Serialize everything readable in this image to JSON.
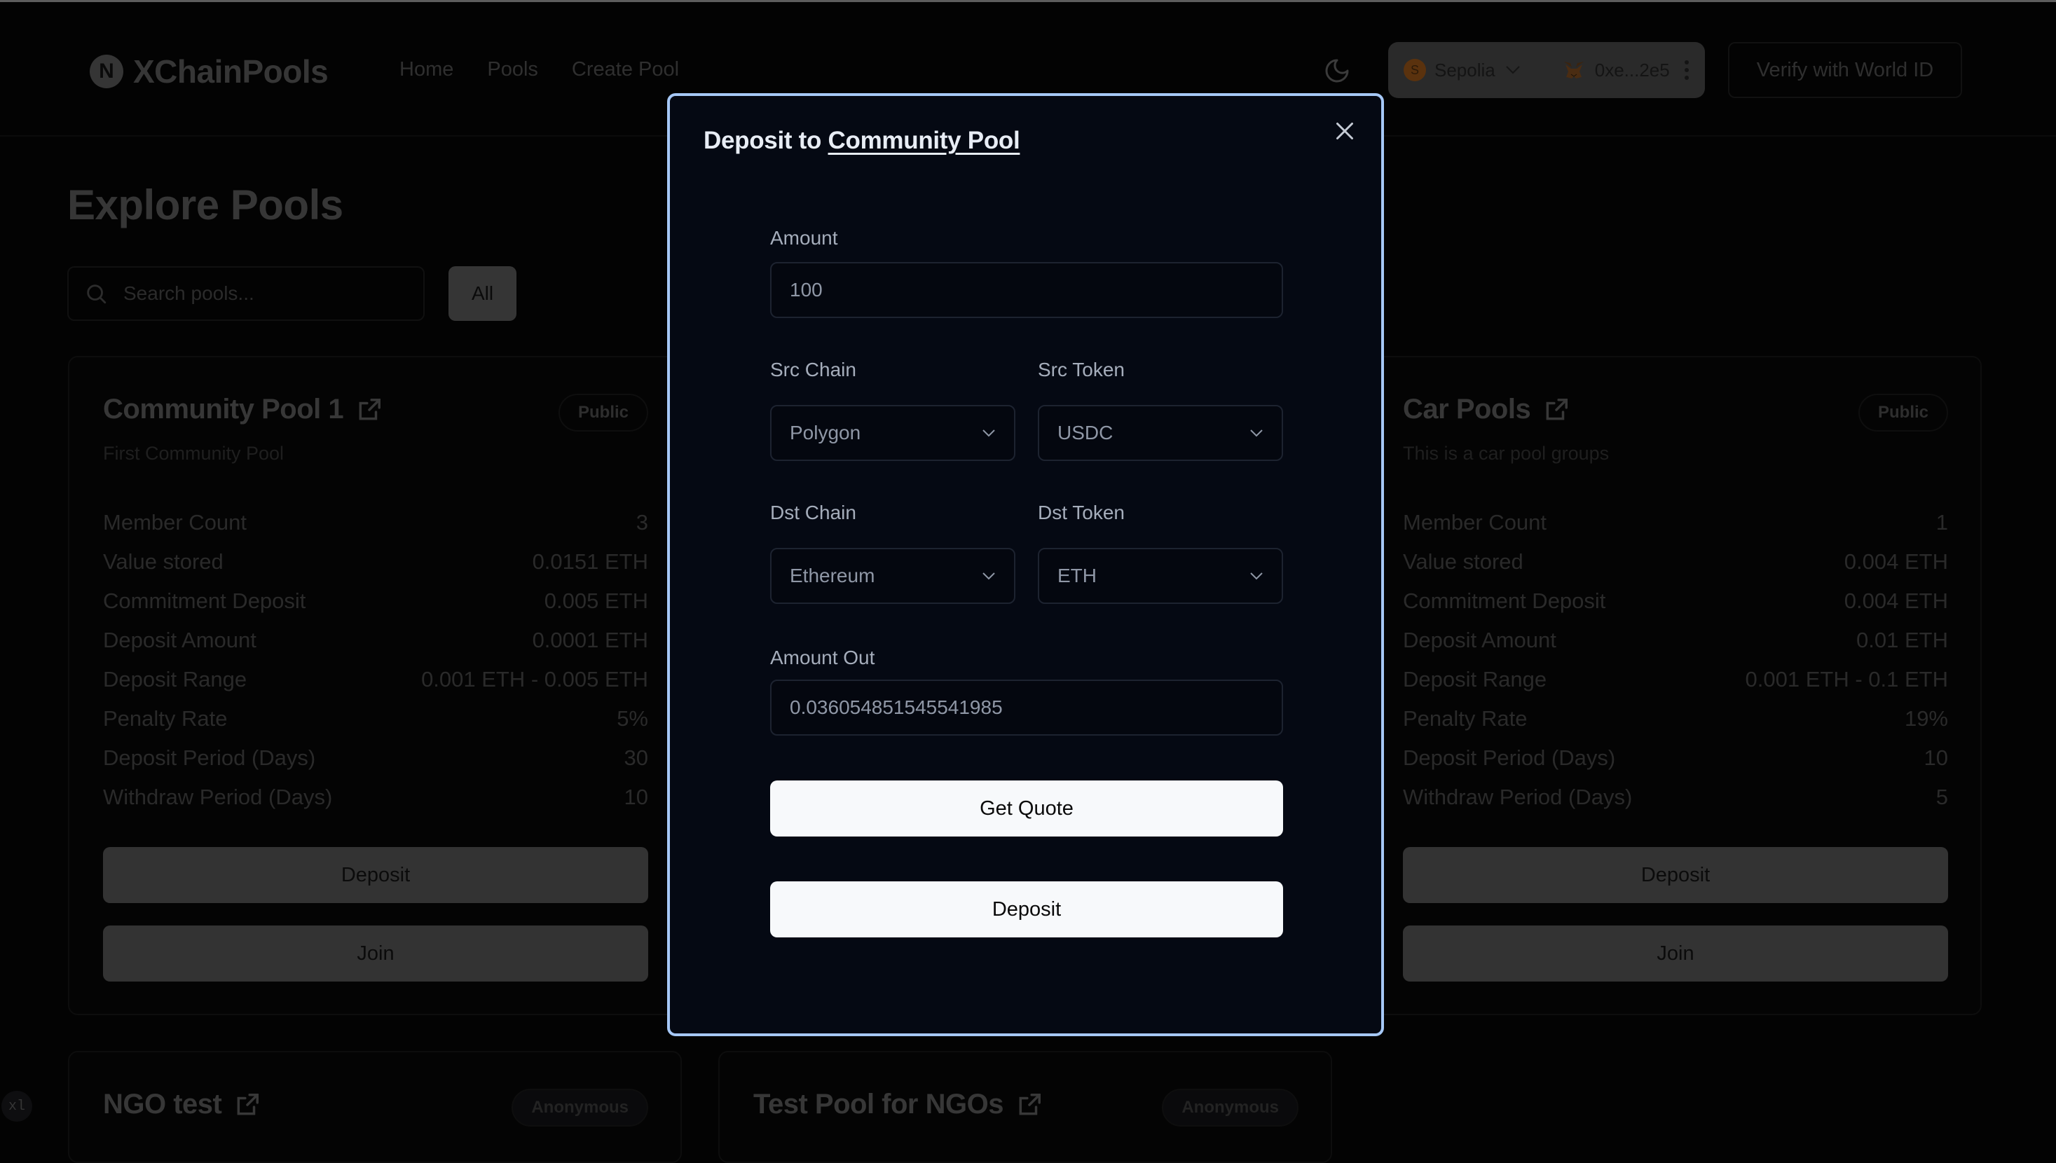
{
  "app": {
    "logo_letter": "N",
    "name": "XChainPools",
    "nav": [
      {
        "label": "Home"
      },
      {
        "label": "Pools"
      },
      {
        "label": "Create Pool"
      }
    ],
    "wallet": {
      "chain_initial": "S",
      "chain": "Sepolia",
      "address": "0xe...2e5"
    },
    "verify_label": "Verify with World ID"
  },
  "main": {
    "title": "Explore Pools",
    "search_placeholder": "Search pools...",
    "filter_label": "All",
    "pools": [
      {
        "name": "Community Pool 1",
        "badge": "Public",
        "description": "First Community Pool",
        "stats": [
          {
            "label": "Member Count",
            "value": "3"
          },
          {
            "label": "Value stored",
            "value": "0.0151 ETH"
          },
          {
            "label": "Commitment Deposit",
            "value": "0.005 ETH"
          },
          {
            "label": "Deposit Amount",
            "value": "0.0001 ETH"
          },
          {
            "label": "Deposit Range",
            "value": "0.001 ETH - 0.005 ETH"
          },
          {
            "label": "Penalty Rate",
            "value": "5%"
          },
          {
            "label": "Deposit Period (Days)",
            "value": "30"
          },
          {
            "label": "Withdraw Period (Days)",
            "value": "10"
          }
        ],
        "deposit_label": "Deposit",
        "join_label": "Join"
      },
      {
        "name": "Car Pools",
        "badge": "Public",
        "description": "This is a car pool groups",
        "stats": [
          {
            "label": "Member Count",
            "value": "1"
          },
          {
            "label": "Value stored",
            "value": "0.004 ETH"
          },
          {
            "label": "Commitment Deposit",
            "value": "0.004 ETH"
          },
          {
            "label": "Deposit Amount",
            "value": "0.01 ETH"
          },
          {
            "label": "Deposit Range",
            "value": "0.001 ETH - 0.1 ETH"
          },
          {
            "label": "Penalty Rate",
            "value": "19%"
          },
          {
            "label": "Deposit Period (Days)",
            "value": "10"
          },
          {
            "label": "Withdraw Period (Days)",
            "value": "5"
          }
        ],
        "deposit_label": "Deposit",
        "join_label": "Join"
      },
      {
        "name": "NGO test",
        "badge": "Anonymous"
      },
      {
        "name": "Test Pool for NGOs",
        "badge": "Anonymous"
      }
    ]
  },
  "modal": {
    "title_prefix": "Deposit to",
    "title_link": "Community Pool",
    "amount_label": "Amount",
    "amount_value": "100",
    "src_chain_label": "Src Chain",
    "src_chain_value": "Polygon",
    "src_token_label": "Src Token",
    "src_token_value": "USDC",
    "dst_chain_label": "Dst Chain",
    "dst_chain_value": "Ethereum",
    "dst_token_label": "Dst Token",
    "dst_token_value": "ETH",
    "amount_out_label": "Amount Out",
    "amount_out_value": "0.036054851545541985",
    "get_quote_label": "Get Quote",
    "deposit_label": "Deposit"
  },
  "dev_badge": "xl",
  "colors": {
    "modal_border": "#a6c8f6",
    "modal_bg": "#050913",
    "primary_button": "#f7f9fb"
  }
}
